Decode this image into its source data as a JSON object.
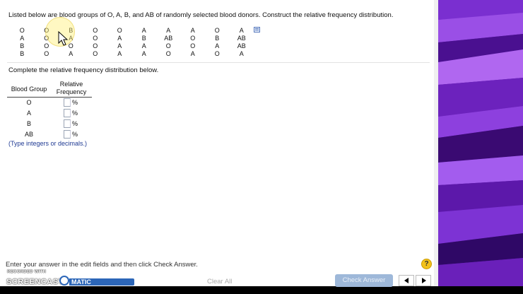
{
  "question": {
    "text": "Listed below are blood groups of O, A, B, and AB of randomly selected blood donors. Construct the relative frequency distribution."
  },
  "data_rows": [
    [
      "O",
      "O",
      "B",
      "O",
      "O",
      "A",
      "A",
      "A",
      "O",
      "A"
    ],
    [
      "A",
      "O",
      "A",
      "O",
      "A",
      "B",
      "AB",
      "O",
      "B",
      "AB"
    ],
    [
      "B",
      "O",
      "O",
      "O",
      "A",
      "A",
      "O",
      "O",
      "A",
      "AB"
    ],
    [
      "B",
      "O",
      "A",
      "O",
      "A",
      "A",
      "O",
      "A",
      "O",
      "A"
    ]
  ],
  "instruction": "Complete the relative frequency distribution below.",
  "table": {
    "col1_header": "Blood Group",
    "col2_header_line1": "Relative",
    "col2_header_line2": "Frequency",
    "rows": [
      {
        "group": "O",
        "value": "",
        "unit": "%"
      },
      {
        "group": "A",
        "value": "",
        "unit": "%"
      },
      {
        "group": "B",
        "value": "",
        "unit": "%"
      },
      {
        "group": "AB",
        "value": "",
        "unit": "%"
      }
    ]
  },
  "hint": "(Type integers or decimals.)",
  "footer": {
    "message": "Enter your answer in the edit fields and then click Check Answer.",
    "help_label": "?",
    "clear_all": "Clear All",
    "check_answer": "Check Answer"
  },
  "recorder": {
    "label": "RECORDED WITH",
    "brand": "SCREENCAST",
    "brand_suffix": "MATIC"
  },
  "colors": {
    "wallpaper": "#5b1aa6",
    "check_button": "#9eb8d9",
    "help_badge": "#f3c21a",
    "hint_text": "#1f3a93"
  },
  "icons": [
    "expand-icon",
    "help-icon",
    "prev-arrow-icon",
    "next-arrow-icon",
    "mouse-pointer-icon"
  ]
}
